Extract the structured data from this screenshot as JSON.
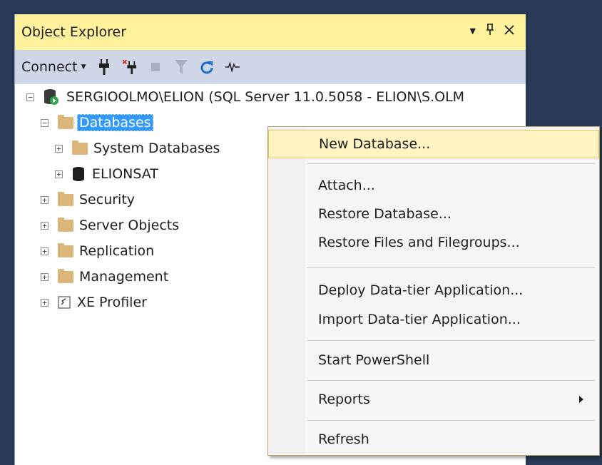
{
  "panel": {
    "title": "Object Explorer",
    "controls": [
      "▼",
      "⊓",
      "×"
    ]
  },
  "toolbar": {
    "connect_label": "Connect",
    "icons": [
      "connect-plug-icon",
      "disconnect-plug-icon",
      "stop-icon",
      "filter-icon",
      "refresh-icon",
      "activity-monitor-icon"
    ]
  },
  "tree": {
    "server": "SERGIOOLMO\\ELION (SQL Server 11.0.5058 - ELION\\S.OLM",
    "databases": "Databases",
    "system_databases": "System Databases",
    "elionsat": "ELIONSAT",
    "security": "Security",
    "server_objects": "Server Objects",
    "replication": "Replication",
    "management": "Management",
    "xe_profiler": "XE Profiler"
  },
  "menu": {
    "new_database": "New Database...",
    "attach": "Attach...",
    "restore_database": "Restore Database...",
    "restore_files": "Restore Files and Filegroups...",
    "deploy_dac": "Deploy Data-tier Application...",
    "import_dac": "Import Data-tier Application...",
    "start_powershell": "Start PowerShell",
    "reports": "Reports",
    "refresh": "Refresh"
  },
  "colors": {
    "background": "#293955",
    "titlebar": "#fff29d",
    "toolbar": "#cfd6e5",
    "selection": "#3399ff",
    "menu_hover": "#fff4c2"
  }
}
